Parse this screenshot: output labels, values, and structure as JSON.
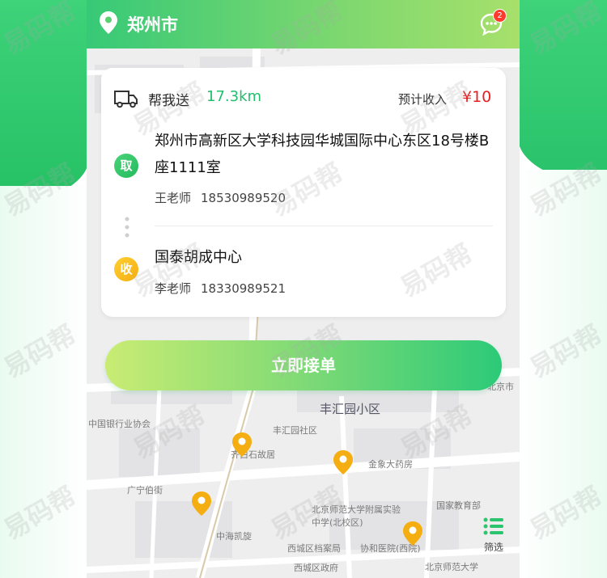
{
  "header": {
    "city": "郑州市",
    "message_badge": "2"
  },
  "order": {
    "service": "帮我送",
    "distance": "17.3km",
    "income_label": "预计收入",
    "income": "¥10",
    "pickup": {
      "tag": "取",
      "address": "郑州市高新区大学科技园华城国际中心东区18号楼B座1111室",
      "contact_name": "王老师",
      "contact_phone": "18530989520"
    },
    "delivery": {
      "tag": "收",
      "address": "国泰胡成中心",
      "contact_name": "李老师",
      "contact_phone": "18330989521"
    }
  },
  "accept_button": "立即接单",
  "filter_label": "筛选",
  "map": {
    "labels": [
      "丰汇园小区",
      "丰汇园社区",
      "中国银行业协会",
      "齐白石故居",
      "金象大药房",
      "广宁伯街",
      "北京师范大学附属实验中学(北校区)",
      "国家教育部",
      "中海凯旋",
      "西城区档案局",
      "协和医院(西院)",
      "西城区政府",
      "北京师范大学",
      "北京市"
    ]
  },
  "watermark": "易码帮",
  "colors": {
    "accent_green": "#1fbf6b",
    "price_red": "#e62020",
    "pickup_green": "#23bb5e",
    "delivery_yellow": "#f4ae11"
  }
}
